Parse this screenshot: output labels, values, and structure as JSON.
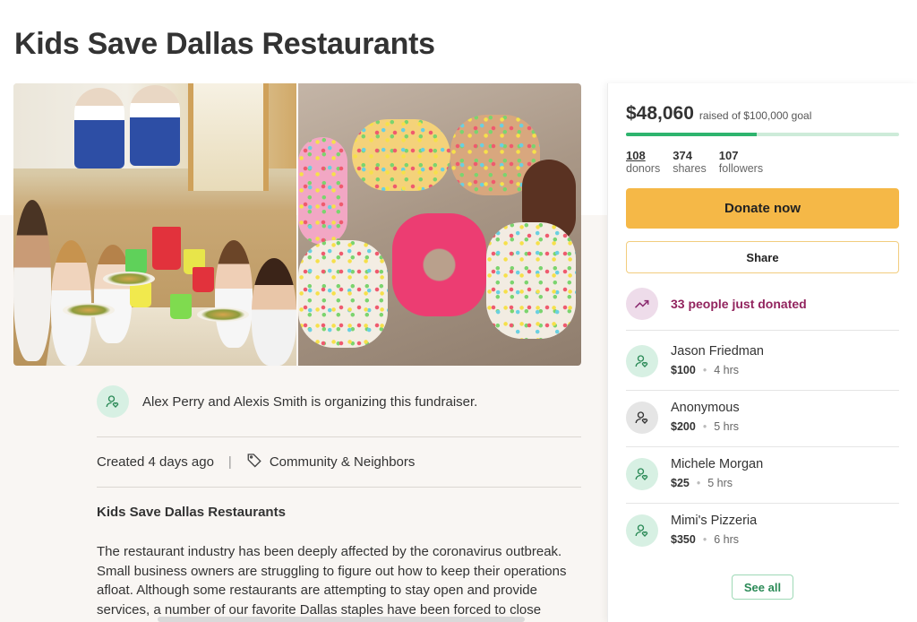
{
  "page": {
    "title": "Kids Save Dallas Restaurants"
  },
  "organizer": {
    "text": "Alex Perry and Alexis Smith is organizing this fundraiser."
  },
  "meta": {
    "created": "Created 4 days ago",
    "separator": "|",
    "category": "Community & Neighbors"
  },
  "story": {
    "title": "Kids Save Dallas Restaurants",
    "body": "The restaurant industry has been deeply affected by the coronavirus outbreak. Small business owners are struggling to figure out how to keep their operations afloat. Although some restaurants are attempting to stay open and provide services, a number of our favorite Dallas staples have been forced to close indefinitely due to"
  },
  "campaign": {
    "raised": "$48,060",
    "goal_text": "raised of $100,000 goal",
    "progress": 0.48,
    "stats": [
      {
        "value": "108",
        "label": "donors"
      },
      {
        "value": "374",
        "label": "shares"
      },
      {
        "value": "107",
        "label": "followers"
      }
    ],
    "donate_label": "Donate now",
    "share_label": "Share",
    "recent_text": "33 people just donated",
    "donations": [
      {
        "name": "Jason Friedman",
        "amount": "$100",
        "time": "4 hrs"
      },
      {
        "name": "Anonymous",
        "amount": "$200",
        "time": "5 hrs"
      },
      {
        "name": "Michele Morgan",
        "amount": "$25",
        "time": "5 hrs"
      },
      {
        "name": "Mimi's Pizzeria",
        "amount": "$350",
        "time": "6 hrs"
      }
    ],
    "see_all_label": "See all"
  },
  "colors": {
    "accent_green": "#2eb46e",
    "donate_yellow": "#f5b847",
    "recent_purple": "#92245e"
  },
  "icons": {
    "organizer": "user-heart-icon",
    "tag": "tag-icon",
    "trend": "trending-up-icon"
  }
}
